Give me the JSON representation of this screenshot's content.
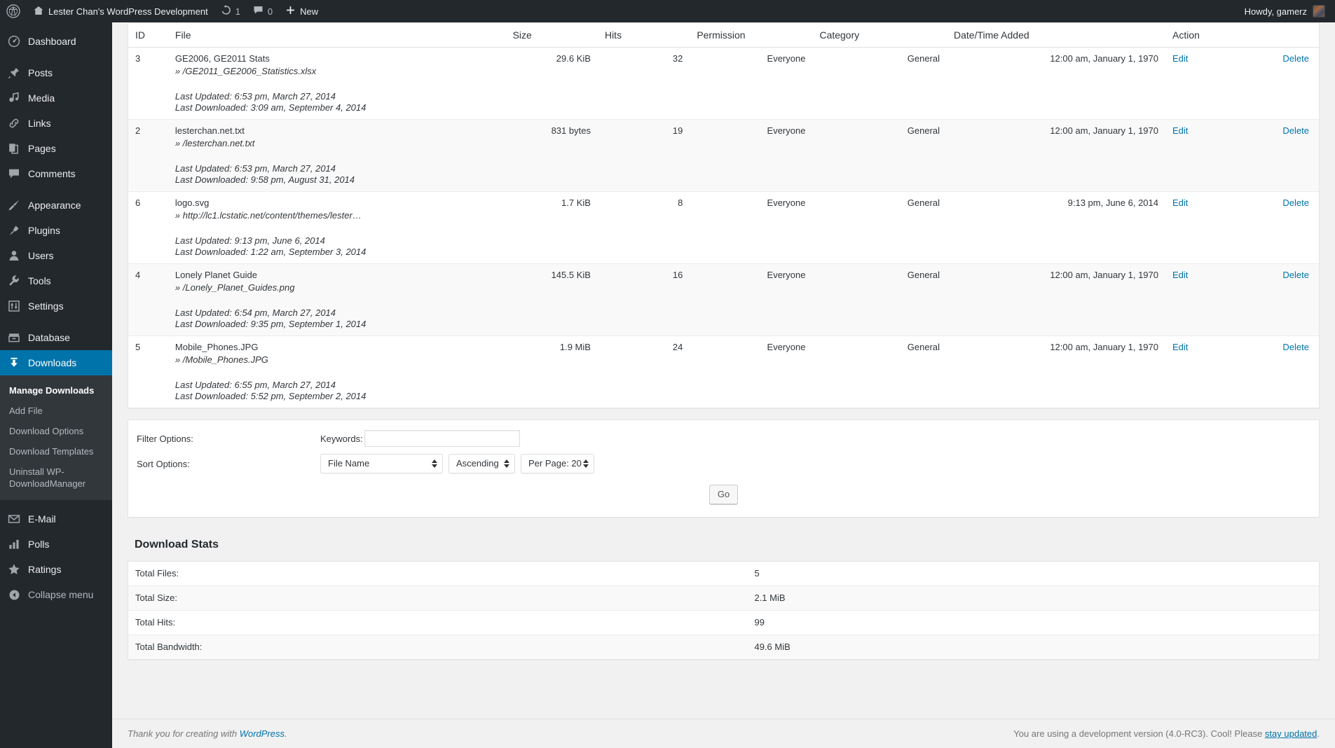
{
  "adminbar": {
    "logo_icon": "wordpress-logo-icon",
    "home_icon": "home-icon",
    "site_title": "Lester Chan's WordPress Development",
    "updates_icon": "updates-icon",
    "updates_count": "1",
    "comments_icon": "comment-bubble-icon",
    "comments_count": "0",
    "new_icon": "plus-icon",
    "new_label": "New",
    "howdy": "Howdy, gamerz",
    "avatar_icon": "user-avatar"
  },
  "sidebar": {
    "items": [
      {
        "label": "Dashboard",
        "icon": "dashboard-icon"
      },
      {
        "label": "Posts",
        "icon": "pin-icon"
      },
      {
        "label": "Media",
        "icon": "media-icon"
      },
      {
        "label": "Links",
        "icon": "link-icon"
      },
      {
        "label": "Pages",
        "icon": "pages-icon"
      },
      {
        "label": "Comments",
        "icon": "comment-bubble-icon"
      },
      {
        "label": "Appearance",
        "icon": "paintbrush-icon"
      },
      {
        "label": "Plugins",
        "icon": "plug-icon"
      },
      {
        "label": "Users",
        "icon": "user-icon"
      },
      {
        "label": "Tools",
        "icon": "wrench-icon"
      },
      {
        "label": "Settings",
        "icon": "sliders-icon"
      },
      {
        "label": "Database",
        "icon": "database-icon"
      },
      {
        "label": "Downloads",
        "icon": "download-icon"
      },
      {
        "label": "E-Mail",
        "icon": "envelope-icon"
      },
      {
        "label": "Polls",
        "icon": "bar-chart-icon"
      },
      {
        "label": "Ratings",
        "icon": "star-icon"
      }
    ],
    "submenu": [
      "Manage Downloads",
      "Add File",
      "Download Options",
      "Download Templates",
      "Uninstall WP-DownloadManager"
    ],
    "collapse": {
      "label": "Collapse menu",
      "icon": "collapse-arrow-icon"
    }
  },
  "table": {
    "columns": [
      "ID",
      "File",
      "Size",
      "Hits",
      "Permission",
      "Category",
      "Date/Time Added",
      "Action"
    ],
    "actions": {
      "edit": "Edit",
      "delete": "Delete"
    },
    "rows": [
      {
        "id": "3",
        "title": "GE2006, GE2011 Stats",
        "path": "» /GE2011_GE2006_Statistics.xlsx",
        "updated": "Last Updated: 6:53 pm, March 27, 2014",
        "downloaded": "Last Downloaded: 3:09 am, September 4, 2014",
        "size": "29.6 KiB",
        "hits": "32",
        "permission": "Everyone",
        "category": "General",
        "date_added": "12:00 am, January 1, 1970"
      },
      {
        "id": "2",
        "title": "lesterchan.net.txt",
        "path": "» /lesterchan.net.txt",
        "updated": "Last Updated: 6:53 pm, March 27, 2014",
        "downloaded": "Last Downloaded: 9:58 pm, August 31, 2014",
        "size": "831 bytes",
        "hits": "19",
        "permission": "Everyone",
        "category": "General",
        "date_added": "12:00 am, January 1, 1970"
      },
      {
        "id": "6",
        "title": "logo.svg",
        "path": "» http://lc1.lcstatic.net/content/themes/lester…",
        "updated": "Last Updated: 9:13 pm, June 6, 2014",
        "downloaded": "Last Downloaded: 1:22 am, September 3, 2014",
        "size": "1.7 KiB",
        "hits": "8",
        "permission": "Everyone",
        "category": "General",
        "date_added": "9:13 pm, June 6, 2014"
      },
      {
        "id": "4",
        "title": "Lonely Planet Guide",
        "path": "» /Lonely_Planet_Guides.png",
        "updated": "Last Updated: 6:54 pm, March 27, 2014",
        "downloaded": "Last Downloaded: 9:35 pm, September 1, 2014",
        "size": "145.5 KiB",
        "hits": "16",
        "permission": "Everyone",
        "category": "General",
        "date_added": "12:00 am, January 1, 1970"
      },
      {
        "id": "5",
        "title": "Mobile_Phones.JPG",
        "path": "» /Mobile_Phones.JPG",
        "updated": "Last Updated: 6:55 pm, March 27, 2014",
        "downloaded": "Last Downloaded: 5:52 pm, September 2, 2014",
        "size": "1.9 MiB",
        "hits": "24",
        "permission": "Everyone",
        "category": "General",
        "date_added": "12:00 am, January 1, 1970"
      }
    ]
  },
  "filter": {
    "filter_label": "Filter Options:",
    "sort_label": "Sort Options:",
    "keywords_label": "Keywords:",
    "keywords_value": "",
    "keywords_placeholder": "",
    "sort_field": "File Name",
    "sort_order": "Ascending",
    "per_page": "Per Page: 20",
    "go_label": "Go"
  },
  "stats": {
    "title": "Download Stats",
    "rows": [
      {
        "label": "Total Files:",
        "value": "5"
      },
      {
        "label": "Total Size:",
        "value": "2.1 MiB"
      },
      {
        "label": "Total Hits:",
        "value": "99"
      },
      {
        "label": "Total Bandwidth:",
        "value": "49.6 MiB"
      }
    ]
  },
  "footer": {
    "thanks_prefix": "Thank you for creating with ",
    "wordpress_link": "WordPress",
    "thanks_suffix": ".",
    "version_text": "You are using a development version (4.0-RC3). Cool! Please ",
    "stay_updated_link": "stay updated",
    "version_suffix": "."
  },
  "colors": {
    "admin_bar": "#23282d",
    "sidebar": "#23282d",
    "submenu": "#32373c",
    "accent": "#0073aa",
    "link": "#0073aa",
    "content_bg": "#f1f1f1"
  }
}
